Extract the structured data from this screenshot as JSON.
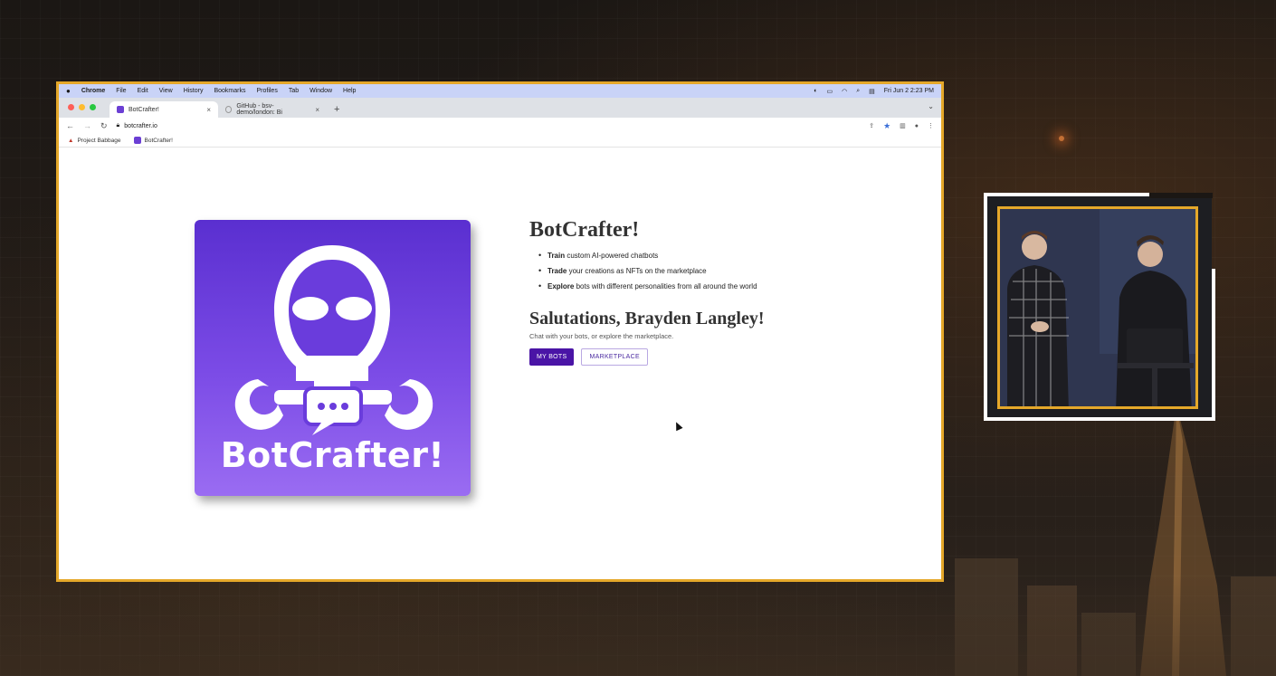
{
  "mac_menubar": {
    "app_name": "Chrome",
    "menus": [
      "File",
      "Edit",
      "View",
      "History",
      "Bookmarks",
      "Profiles",
      "Tab",
      "Window",
      "Help"
    ],
    "clock": "Fri Jun 2  2:23 PM"
  },
  "tabs": [
    {
      "title": "BotCrafter!",
      "close": "×"
    },
    {
      "title": "GitHub - bsv-demo/london: Bi",
      "close": "×"
    }
  ],
  "new_tab": "+",
  "tab_menu": "⌄",
  "address_bar": {
    "url": "botcrafter.io"
  },
  "bookmarks": [
    {
      "label": "Project Babbage"
    },
    {
      "label": "BotCrafter!"
    }
  ],
  "logo": {
    "wordmark": "BotCrafter!"
  },
  "site": {
    "title": "BotCrafter!",
    "features": [
      {
        "bold": "Train",
        "text": " custom AI-powered chatbots"
      },
      {
        "bold": "Trade",
        "text": " your creations as NFTs on the marketplace"
      },
      {
        "bold": "Explore",
        "text": " bots with different personalities from all around the world"
      }
    ],
    "greeting": "Salutations, Brayden Langley!",
    "subtitle": "Chat with your bots, or explore the marketplace.",
    "buttons": {
      "my_bots": "MY BOTS",
      "marketplace": "MARKETPLACE"
    }
  },
  "colors": {
    "frame_accent": "#e5a82a",
    "primary_button": "#4a14a6",
    "logo_gradient_top": "#5a2fd0",
    "logo_gradient_bottom": "#9a6cf2"
  }
}
